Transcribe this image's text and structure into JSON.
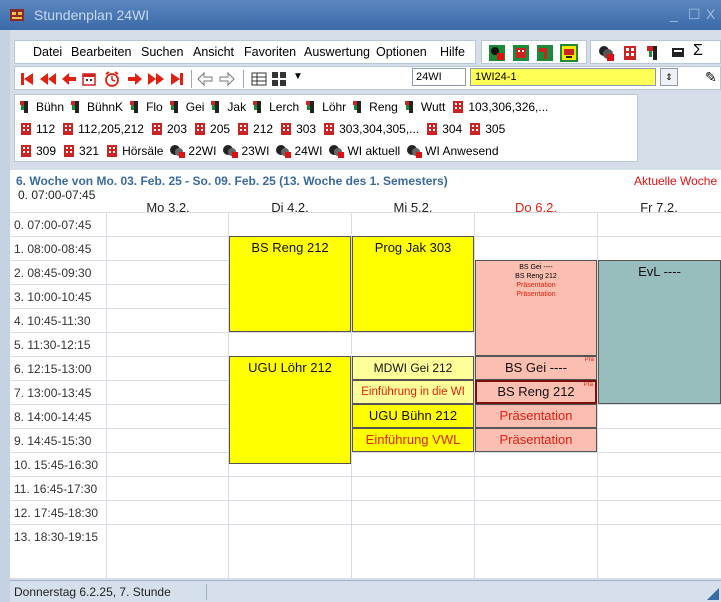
{
  "window": {
    "title": "Stundenplan 24WI",
    "min_label": "_",
    "max_label": "☐",
    "close_label": "X"
  },
  "menu": [
    "Datei",
    "Bearbeiten",
    "Suchen",
    "Ansicht",
    "Favoriten",
    "Auswertung",
    "Optionen",
    "Hilfe"
  ],
  "nav": {
    "class_value": "24WI",
    "group_value": "1WI24-1"
  },
  "quick": {
    "row1": [
      "Bühn",
      "BühnK",
      "Flo",
      "Gei",
      "Jak",
      "Lerch",
      "Löhr",
      "Reng",
      "Wutt",
      "103,306,326,..."
    ],
    "row2": [
      "112",
      "112,205,212",
      "203",
      "205",
      "212",
      "303",
      "303,304,305,...",
      "304",
      "305"
    ],
    "row3": [
      "309",
      "321",
      "Hörsäle",
      "22WI",
      "23WI",
      "24WI",
      "WI aktuell",
      "WI Anwesend"
    ]
  },
  "schedule": {
    "week_title": "6. Woche von Mo. 03. Feb. 25 - So. 09. Feb. 25 (13. Woche des 1. Semesters)",
    "current_week": "Aktuelle Woche",
    "first_slot": "0. 07:00-07:45",
    "days": [
      "Mo 3.2.",
      "Di 4.2.",
      "Mi 5.2.",
      "Do 6.2.",
      "Fr 7.2."
    ],
    "today_color": "#e02010",
    "slots": [
      "0. 07:00-07:45",
      "1. 08:00-08:45",
      "2. 08:45-09:30",
      "3. 10:00-10:45",
      "4. 10:45-11:30",
      "5. 11:30-12:15",
      "6. 12:15-13:00",
      "7. 13:00-13:45",
      "8. 14:00-14:45",
      "9. 14:45-15:30",
      "10. 15:45-16:30",
      "11. 16:45-17:30",
      "12. 17:45-18:30",
      "13. 18:30-19:15"
    ],
    "lessons": {
      "di1": "BS Reng 212",
      "mi1": "Prog Jak 303",
      "do2a": "BS Gei ----",
      "do2b": "BS Reng 212",
      "do2c": "Präsentation",
      "do2d": "Präsentation",
      "fr2": "EvL ----",
      "di6": "UGU Löhr 212",
      "mi6": "MDWI Gei 212",
      "mi7": "Einführung in die WI",
      "mi8": "UGU Bühn 212",
      "mi9": "Einführung VWL",
      "do6": "BS Gei ----",
      "do7": "BS Reng 212",
      "do8": "Präsentation",
      "do9": "Präsentation",
      "badge": "Prä"
    }
  },
  "status": {
    "text": "Donnerstag 6.2.25, 7. Stunde"
  }
}
